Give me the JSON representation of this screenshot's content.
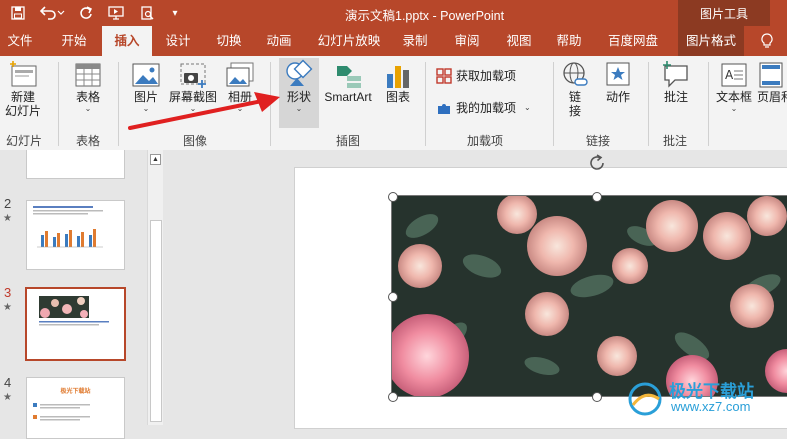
{
  "title_bar": {
    "doc_title": "演示文稿1.pptx  -  PowerPoint",
    "context_group": "图片工具"
  },
  "tabs": [
    {
      "label": "文件",
      "active": false
    },
    {
      "label": "开始",
      "active": false
    },
    {
      "label": "插入",
      "active": true
    },
    {
      "label": "设计",
      "active": false
    },
    {
      "label": "切换",
      "active": false
    },
    {
      "label": "动画",
      "active": false
    },
    {
      "label": "幻灯片放映",
      "active": false
    },
    {
      "label": "录制",
      "active": false
    },
    {
      "label": "审阅",
      "active": false
    },
    {
      "label": "视图",
      "active": false
    },
    {
      "label": "帮助",
      "active": false
    },
    {
      "label": "百度网盘",
      "active": false
    },
    {
      "label": "图片格式",
      "active": false
    }
  ],
  "ribbon": {
    "new_slide": "新建\n幻灯片",
    "table": "表格",
    "picture": "图片",
    "screenshot": "屏幕截图",
    "album": "相册",
    "shapes": "形状",
    "smartart": "SmartArt",
    "chart": "图表",
    "get_addins": "获取加载项",
    "my_addins": "我的加载项",
    "link": "链\n接",
    "action": "动作",
    "comment": "批注",
    "textbox": "文本框",
    "header_footer": "页眉和",
    "groups": {
      "slides": "幻灯片",
      "tables": "表格",
      "images": "图像",
      "illustrations": "插图",
      "addins": "加载项",
      "links": "链接",
      "comments": "批注"
    }
  },
  "thumbnails": [
    {
      "number": "2",
      "star": "★"
    },
    {
      "number": "3",
      "star": "★",
      "selected": true
    },
    {
      "number": "4",
      "star": "★",
      "title": "极光下载站"
    }
  ],
  "watermark": {
    "name": "极光下载站",
    "url": "www.xz7.com"
  },
  "colors": {
    "brand": "#b7472a",
    "brand_dark": "#8c3a22",
    "arrow": "#e02020"
  }
}
